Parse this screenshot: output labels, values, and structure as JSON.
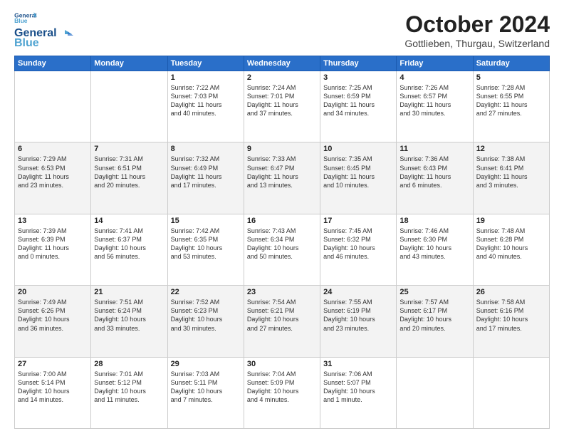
{
  "logo": {
    "line1": "General",
    "line2": "Blue"
  },
  "title": "October 2024",
  "subtitle": "Gottlieben, Thurgau, Switzerland",
  "days_of_week": [
    "Sunday",
    "Monday",
    "Tuesday",
    "Wednesday",
    "Thursday",
    "Friday",
    "Saturday"
  ],
  "weeks": [
    [
      {
        "day": "",
        "info": ""
      },
      {
        "day": "",
        "info": ""
      },
      {
        "day": "1",
        "info": "Sunrise: 7:22 AM\nSunset: 7:03 PM\nDaylight: 11 hours\nand 40 minutes."
      },
      {
        "day": "2",
        "info": "Sunrise: 7:24 AM\nSunset: 7:01 PM\nDaylight: 11 hours\nand 37 minutes."
      },
      {
        "day": "3",
        "info": "Sunrise: 7:25 AM\nSunset: 6:59 PM\nDaylight: 11 hours\nand 34 minutes."
      },
      {
        "day": "4",
        "info": "Sunrise: 7:26 AM\nSunset: 6:57 PM\nDaylight: 11 hours\nand 30 minutes."
      },
      {
        "day": "5",
        "info": "Sunrise: 7:28 AM\nSunset: 6:55 PM\nDaylight: 11 hours\nand 27 minutes."
      }
    ],
    [
      {
        "day": "6",
        "info": "Sunrise: 7:29 AM\nSunset: 6:53 PM\nDaylight: 11 hours\nand 23 minutes."
      },
      {
        "day": "7",
        "info": "Sunrise: 7:31 AM\nSunset: 6:51 PM\nDaylight: 11 hours\nand 20 minutes."
      },
      {
        "day": "8",
        "info": "Sunrise: 7:32 AM\nSunset: 6:49 PM\nDaylight: 11 hours\nand 17 minutes."
      },
      {
        "day": "9",
        "info": "Sunrise: 7:33 AM\nSunset: 6:47 PM\nDaylight: 11 hours\nand 13 minutes."
      },
      {
        "day": "10",
        "info": "Sunrise: 7:35 AM\nSunset: 6:45 PM\nDaylight: 11 hours\nand 10 minutes."
      },
      {
        "day": "11",
        "info": "Sunrise: 7:36 AM\nSunset: 6:43 PM\nDaylight: 11 hours\nand 6 minutes."
      },
      {
        "day": "12",
        "info": "Sunrise: 7:38 AM\nSunset: 6:41 PM\nDaylight: 11 hours\nand 3 minutes."
      }
    ],
    [
      {
        "day": "13",
        "info": "Sunrise: 7:39 AM\nSunset: 6:39 PM\nDaylight: 11 hours\nand 0 minutes."
      },
      {
        "day": "14",
        "info": "Sunrise: 7:41 AM\nSunset: 6:37 PM\nDaylight: 10 hours\nand 56 minutes."
      },
      {
        "day": "15",
        "info": "Sunrise: 7:42 AM\nSunset: 6:35 PM\nDaylight: 10 hours\nand 53 minutes."
      },
      {
        "day": "16",
        "info": "Sunrise: 7:43 AM\nSunset: 6:34 PM\nDaylight: 10 hours\nand 50 minutes."
      },
      {
        "day": "17",
        "info": "Sunrise: 7:45 AM\nSunset: 6:32 PM\nDaylight: 10 hours\nand 46 minutes."
      },
      {
        "day": "18",
        "info": "Sunrise: 7:46 AM\nSunset: 6:30 PM\nDaylight: 10 hours\nand 43 minutes."
      },
      {
        "day": "19",
        "info": "Sunrise: 7:48 AM\nSunset: 6:28 PM\nDaylight: 10 hours\nand 40 minutes."
      }
    ],
    [
      {
        "day": "20",
        "info": "Sunrise: 7:49 AM\nSunset: 6:26 PM\nDaylight: 10 hours\nand 36 minutes."
      },
      {
        "day": "21",
        "info": "Sunrise: 7:51 AM\nSunset: 6:24 PM\nDaylight: 10 hours\nand 33 minutes."
      },
      {
        "day": "22",
        "info": "Sunrise: 7:52 AM\nSunset: 6:23 PM\nDaylight: 10 hours\nand 30 minutes."
      },
      {
        "day": "23",
        "info": "Sunrise: 7:54 AM\nSunset: 6:21 PM\nDaylight: 10 hours\nand 27 minutes."
      },
      {
        "day": "24",
        "info": "Sunrise: 7:55 AM\nSunset: 6:19 PM\nDaylight: 10 hours\nand 23 minutes."
      },
      {
        "day": "25",
        "info": "Sunrise: 7:57 AM\nSunset: 6:17 PM\nDaylight: 10 hours\nand 20 minutes."
      },
      {
        "day": "26",
        "info": "Sunrise: 7:58 AM\nSunset: 6:16 PM\nDaylight: 10 hours\nand 17 minutes."
      }
    ],
    [
      {
        "day": "27",
        "info": "Sunrise: 7:00 AM\nSunset: 5:14 PM\nDaylight: 10 hours\nand 14 minutes."
      },
      {
        "day": "28",
        "info": "Sunrise: 7:01 AM\nSunset: 5:12 PM\nDaylight: 10 hours\nand 11 minutes."
      },
      {
        "day": "29",
        "info": "Sunrise: 7:03 AM\nSunset: 5:11 PM\nDaylight: 10 hours\nand 7 minutes."
      },
      {
        "day": "30",
        "info": "Sunrise: 7:04 AM\nSunset: 5:09 PM\nDaylight: 10 hours\nand 4 minutes."
      },
      {
        "day": "31",
        "info": "Sunrise: 7:06 AM\nSunset: 5:07 PM\nDaylight: 10 hours\nand 1 minute."
      },
      {
        "day": "",
        "info": ""
      },
      {
        "day": "",
        "info": ""
      }
    ]
  ]
}
